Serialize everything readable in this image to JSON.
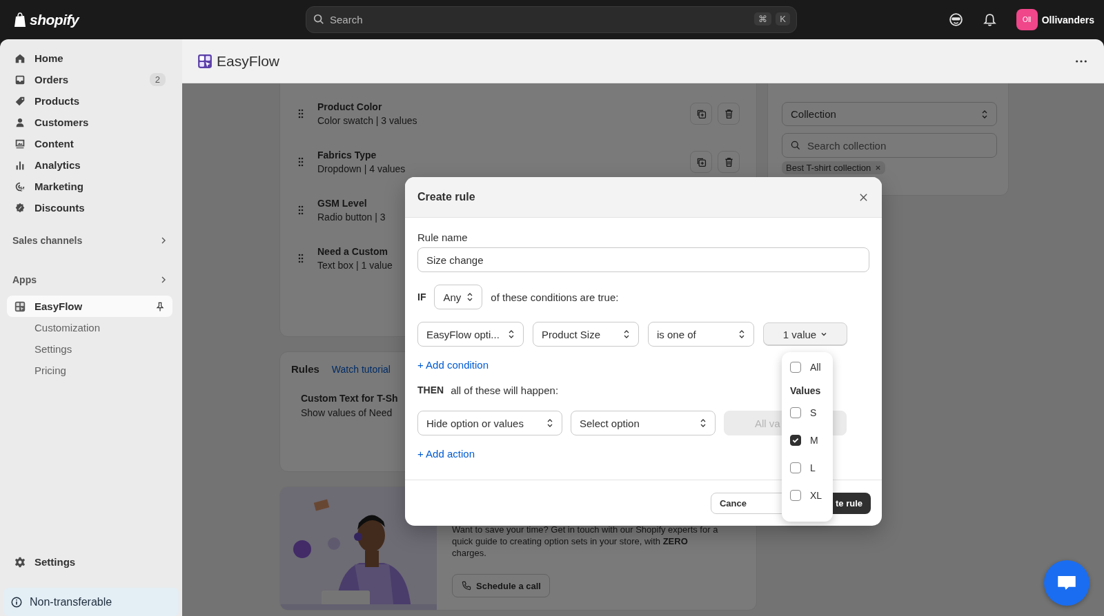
{
  "topbar": {
    "brand": "shopify",
    "search": {
      "placeholder": "Search",
      "keys": [
        "⌘",
        "K"
      ]
    },
    "store": {
      "initials": "Oll",
      "name": "Ollivanders"
    }
  },
  "sidebar": {
    "items": [
      {
        "label": "Home",
        "selected": false
      },
      {
        "label": "Orders",
        "badge": "2",
        "selected": false
      },
      {
        "label": "Products",
        "selected": false
      },
      {
        "label": "Customers",
        "selected": false
      },
      {
        "label": "Content",
        "selected": false
      },
      {
        "label": "Analytics",
        "selected": false
      },
      {
        "label": "Marketing",
        "selected": false
      },
      {
        "label": "Discounts",
        "selected": false
      }
    ],
    "sections": [
      "Sales channels",
      "Apps"
    ],
    "app": {
      "label": "EasyFlow",
      "selected": true,
      "children": [
        {
          "label": "Customization",
          "selected": false
        },
        {
          "label": "Settings",
          "selected": false
        },
        {
          "label": "Pricing",
          "selected": false
        }
      ]
    },
    "settings": "Settings",
    "notice": "Non-transferable"
  },
  "page": {
    "title": "EasyFlow"
  },
  "options": [
    {
      "title": "Product Color",
      "detail": "Color swatch | 3 values",
      "actions": [
        {
          "kind": "duplicate"
        },
        {
          "kind": "delete"
        }
      ]
    },
    {
      "title": "Fabrics Type",
      "detail": "Dropdown | 4 values",
      "actions": [
        {
          "kind": "duplicate"
        },
        {
          "kind": "delete"
        }
      ]
    },
    {
      "title": "GSM Level",
      "detail": "Radio button | 3"
    },
    {
      "title": "Need a Custom",
      "detail": "Text box | 1 value"
    }
  ],
  "rules_card": {
    "title": "Rules",
    "link": "Watch tutorial",
    "rules": [
      {
        "title": "Custom Text for T-Sh",
        "detail": "Show values of Need"
      }
    ]
  },
  "promo": {
    "kind": "picture",
    "text": "Want to save your time? Get in touch with our Shopify experts for a quick guide to creating option sets in your store, with **ZERO** charges.",
    "button": "Schedule a call"
  },
  "type_card": {
    "select": "Collection",
    "search_placeholder": "Search collection",
    "chips": [
      "Best T-shirt collection"
    ]
  },
  "modal": {
    "title": "Create rule",
    "rule_name": {
      "label": "Rule name",
      "value": "Size change"
    },
    "if": {
      "keyword": "IF",
      "match": "Any",
      "suffix": "of these conditions are true:"
    },
    "conditions": [
      {
        "source": "EasyFlow opti...",
        "option": "Product Size",
        "operator": "is one of",
        "value": "1 value"
      }
    ],
    "add_condition": "+ Add condition",
    "then": {
      "keyword": "THEN",
      "suffix": "all of these will happen:"
    },
    "actions": [
      {
        "action": "Hide option or values",
        "target": "Select option",
        "values": {
          "label": "All va",
          "disabled": true
        }
      }
    ],
    "add_action": "+ Add action",
    "cancel": "Cance",
    "create": "te rule"
  },
  "value_menu": {
    "all": {
      "label": "All",
      "checked": false
    },
    "heading": "Values",
    "options": [
      {
        "label": "S",
        "checked": false
      },
      {
        "label": "M",
        "checked": true
      },
      {
        "label": "L",
        "checked": false
      },
      {
        "label": "XL",
        "checked": false
      }
    ]
  }
}
